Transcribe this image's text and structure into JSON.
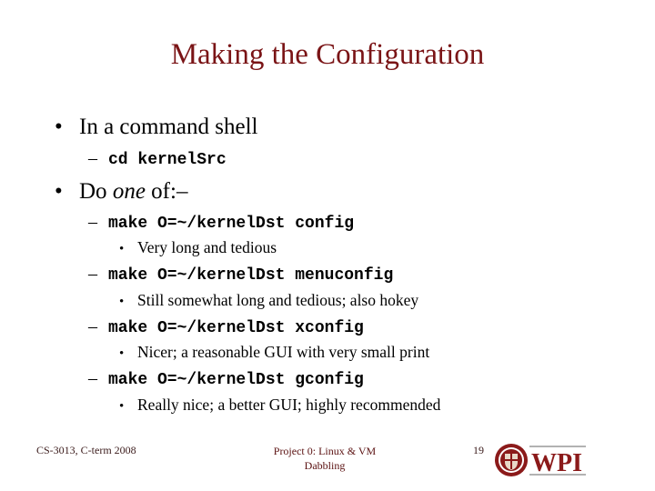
{
  "slide": {
    "title": "Making the Configuration",
    "bullets": [
      {
        "text": "In a command shell",
        "sub": [
          {
            "code": "cd kernelSrc"
          }
        ]
      },
      {
        "text_before": "Do ",
        "text_italic": "one",
        "text_after": " of:–",
        "sub": [
          {
            "code": "make O=~/kernelDst config",
            "note": "Very long and tedious"
          },
          {
            "code": "make O=~/kernelDst menuconfig",
            "note": "Still somewhat long and tedious; also hokey"
          },
          {
            "code": "make O=~/kernelDst xconfig",
            "note": "Nicer; a reasonable GUI with very small print"
          },
          {
            "code": "make O=~/kernelDst gconfig",
            "note": "Really nice; a better GUI; highly recommended"
          }
        ]
      }
    ],
    "bullet_glyph": "•",
    "dash_glyph": "–"
  },
  "footer": {
    "course": "CS-3013, C-term 2008",
    "project_line1": "Project 0: Linux & VM",
    "project_line2": "Dabbling",
    "page_number": "19",
    "logo_text": "WPI",
    "logo_name": "wpi-logo"
  },
  "colors": {
    "title": "#7a1416",
    "brand": "#8b1a1a"
  }
}
